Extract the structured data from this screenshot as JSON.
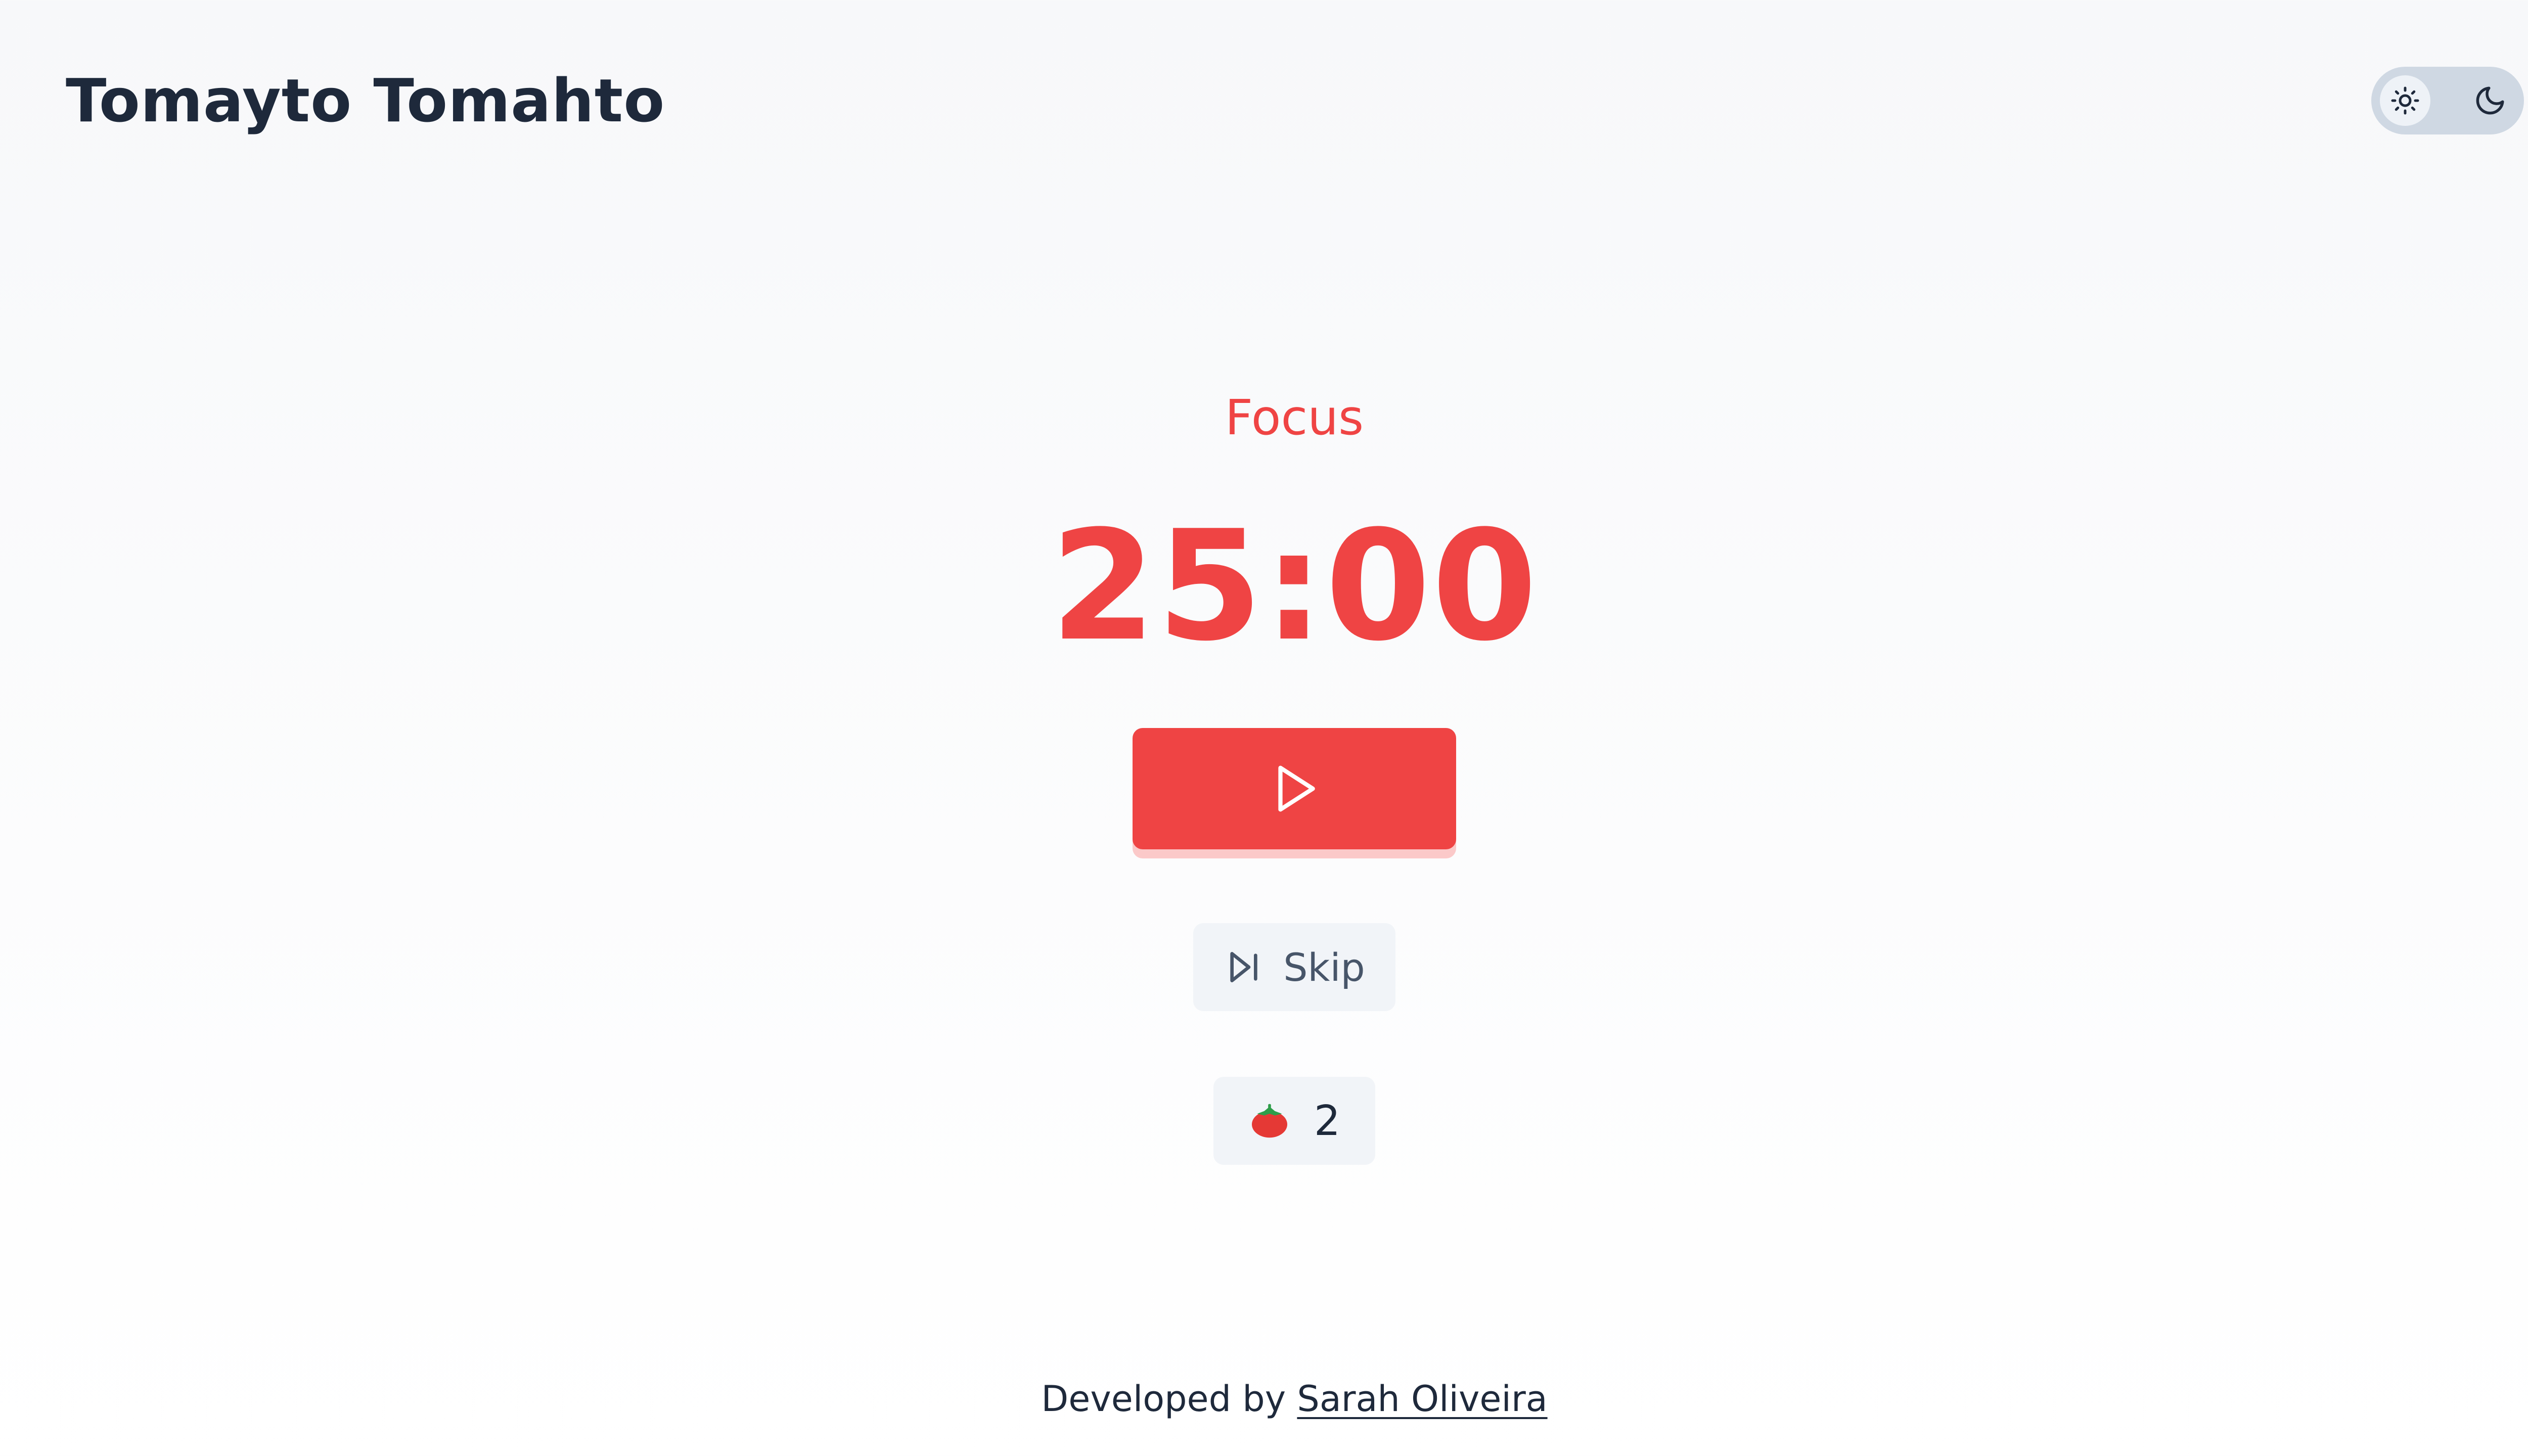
{
  "app": {
    "title": "Tomayto Tomahto"
  },
  "theme_toggle": {
    "options": [
      {
        "name": "light",
        "icon": "sun-icon",
        "selected": true
      },
      {
        "name": "dark",
        "icon": "moon-icon",
        "selected": false
      }
    ]
  },
  "timer": {
    "mode_label": "Focus",
    "time": "25:00",
    "play_icon": "play-icon"
  },
  "skip": {
    "label": "Skip",
    "icon": "skip-forward-icon"
  },
  "pomodoro_count": {
    "icon": "tomato-icon",
    "value": "2"
  },
  "footer": {
    "prefix": "Developed by ",
    "author": "Sarah Oliveira"
  },
  "colors": {
    "accent": "#ef4444",
    "text": "#1e293b",
    "toggle_track": "#cfd8e3",
    "button_secondary": "#f1f4f8"
  }
}
